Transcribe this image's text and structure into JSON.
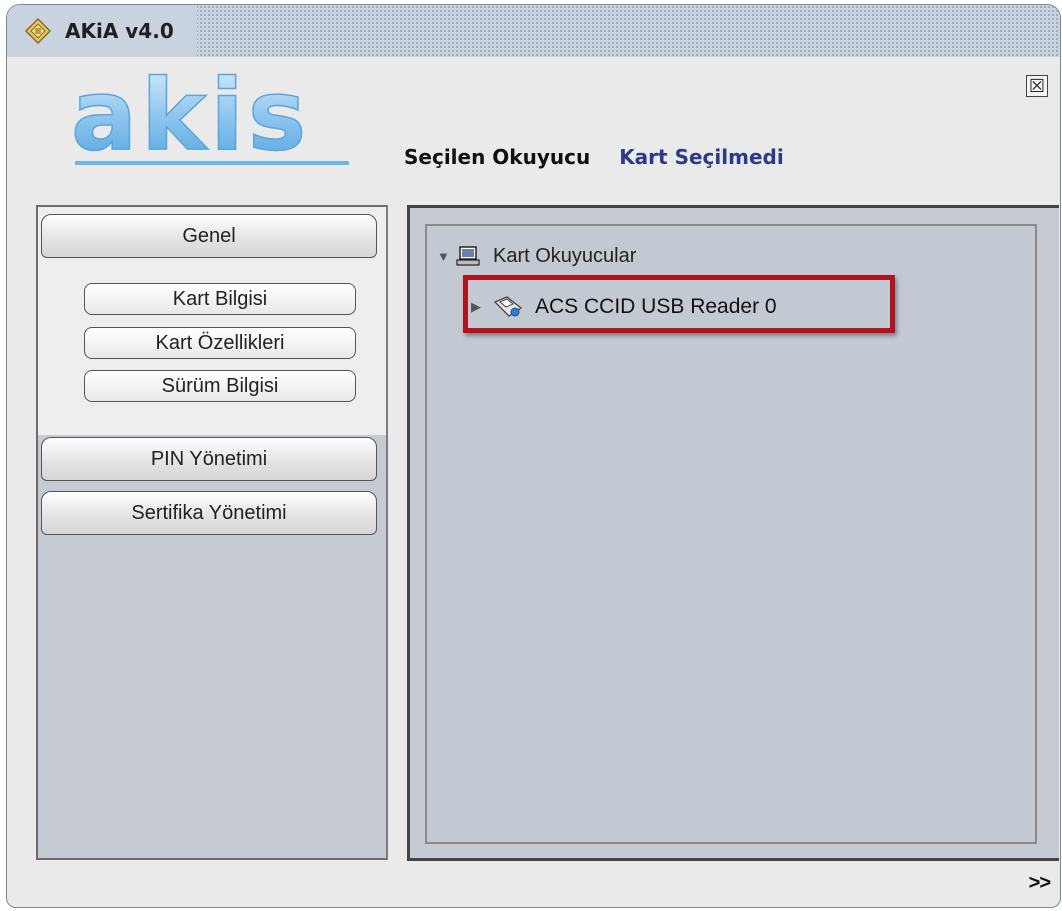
{
  "window": {
    "title": "AKiA v4.0",
    "close_symbol": "☒"
  },
  "logo": {
    "text": "akis"
  },
  "status": {
    "label": "Seçilen Okuyucu",
    "value": "Kart Seçilmedi"
  },
  "sidebar": {
    "sections": [
      {
        "label": "Genel"
      },
      {
        "label": "PIN Yönetimi"
      },
      {
        "label": "Sertifika Yönetimi"
      }
    ],
    "genel_items": [
      {
        "label": "Kart Bilgisi"
      },
      {
        "label": "Kart Özellikleri"
      },
      {
        "label": "Sürüm Bilgisi"
      }
    ]
  },
  "tree": {
    "root_label": "Kart Okuyucular",
    "root_expander": "▼",
    "children": [
      {
        "label": "ACS CCID USB Reader 0",
        "expander": "▶"
      }
    ]
  },
  "footer": {
    "expand_label": ">>"
  },
  "colors": {
    "status_value": "#2b3a8c",
    "highlight": "#b0141e",
    "panel_bg": "#c6cbd3"
  }
}
